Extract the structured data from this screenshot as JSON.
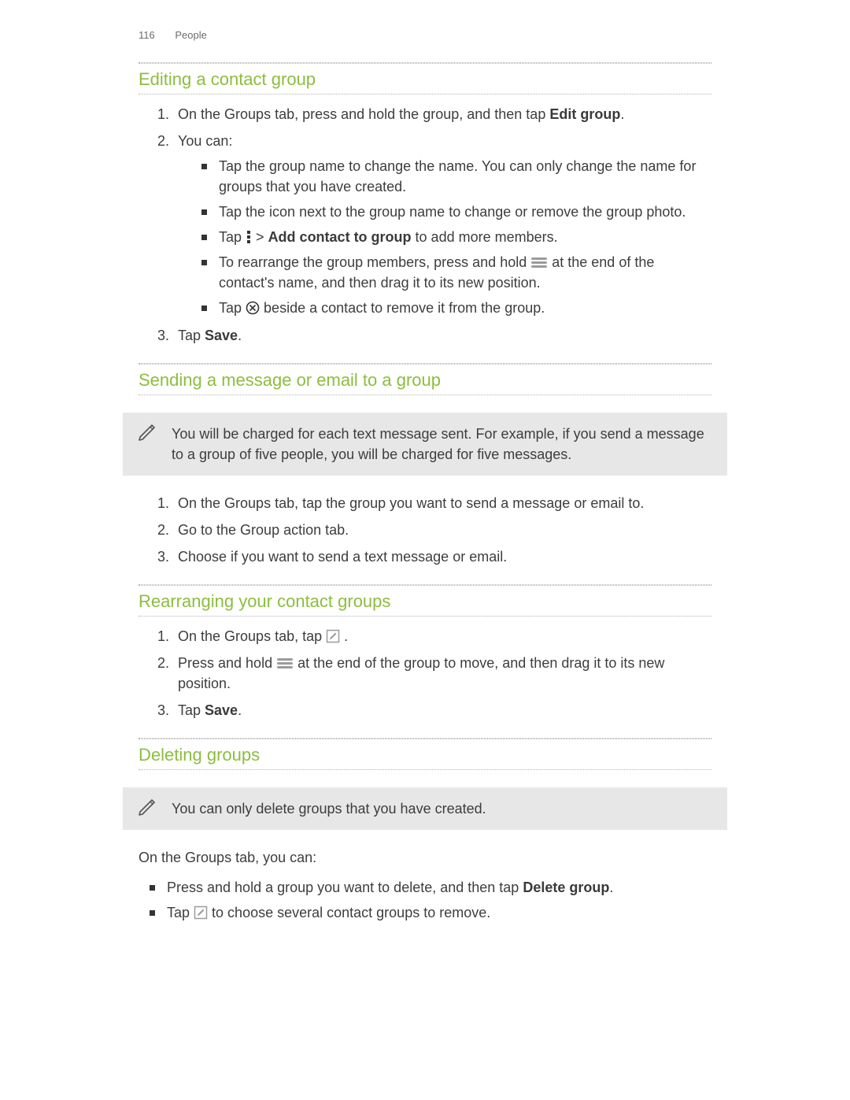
{
  "header": {
    "page_number": "116",
    "section": "People"
  },
  "s1": {
    "title": "Editing a contact group",
    "step1_a": "On the Groups tab, press and hold the group, and then tap ",
    "step1_b": "Edit group",
    "step1_c": ".",
    "step2": "You can:",
    "b1": "Tap the group name to change the name. You can only change the name for groups that you have created.",
    "b2": "Tap the icon next to the group name to change or remove the group photo.",
    "b3_a": "Tap ",
    "b3_b": " > ",
    "b3_c": "Add contact to group",
    "b3_d": " to add more members.",
    "b4_a": "To rearrange the group members, press and hold ",
    "b4_b": " at the end of the contact's name, and then drag it to its new position.",
    "b5_a": "Tap ",
    "b5_b": " beside a contact to remove it from the group.",
    "step3_a": "Tap ",
    "step3_b": "Save",
    "step3_c": "."
  },
  "s2": {
    "title": "Sending a message or email to a group",
    "note": "You will be charged for each text message sent. For example, if you send a message to a group of five people, you will be charged for five messages.",
    "step1": "On the Groups tab, tap the group you want to send a message or email to.",
    "step2": "Go to the Group action tab.",
    "step3": "Choose if you want to send a text message or email."
  },
  "s3": {
    "title": "Rearranging your contact groups",
    "step1_a": "On the Groups tab, tap ",
    "step1_b": " .",
    "step2_a": "Press and hold ",
    "step2_b": " at the end of the group to move, and then drag it to its new position.",
    "step3_a": "Tap ",
    "step3_b": "Save",
    "step3_c": "."
  },
  "s4": {
    "title": "Deleting groups",
    "note": "You can only delete groups that you have created.",
    "intro": "On the Groups tab, you can:",
    "b1_a": "Press and hold a group you want to delete, and then tap ",
    "b1_b": "Delete group",
    "b1_c": ".",
    "b2_a": "Tap ",
    "b2_b": " to choose several contact groups to remove."
  }
}
